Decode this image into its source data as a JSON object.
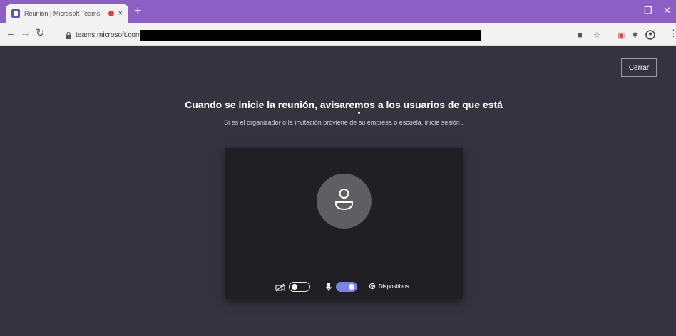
{
  "browser": {
    "tab_title": "Reunión | Microsoft Teams",
    "tab_close": "×",
    "new_tab": "+",
    "window_controls": {
      "minimize": "–",
      "restore": "❐",
      "close": "✕"
    },
    "url_visible": "teams.microsoft.com/",
    "toolbar_icons": [
      "camera-icon",
      "star-icon",
      "extension-icon",
      "puzzle-icon",
      "profile-icon",
      "menu-icon"
    ]
  },
  "meeting": {
    "close_label": "Cerrar",
    "heading": "Cuando se inicie la reunión, avisaremos a los usuarios de que está",
    "subtext": "Si es el organizador o la invitación proviene de su empresa o escuela, inicie sesión .",
    "camera_toggle": "off",
    "mic_toggle": "on",
    "devices_label": "Dispositivos"
  },
  "colors": {
    "titlebar": "#8b5fc3",
    "background": "#35333f",
    "preview": "#201f24",
    "avatar": "#5e5e63",
    "accent": "#7b83eb"
  }
}
